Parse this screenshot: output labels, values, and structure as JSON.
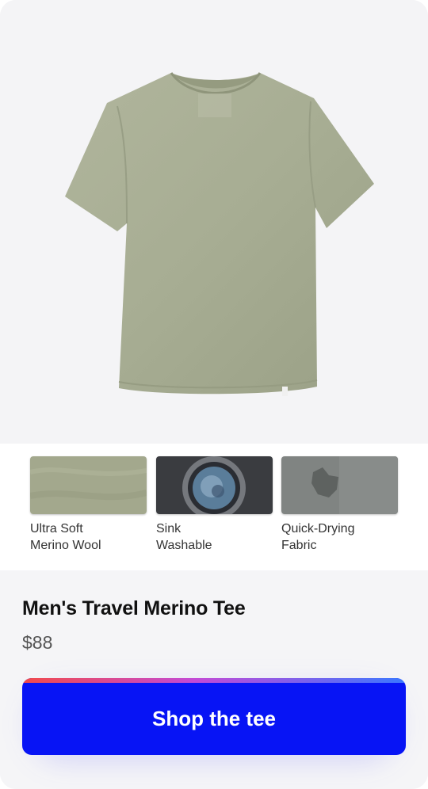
{
  "product": {
    "image_icon": "green-tshirt-image",
    "name": "Men's Travel Merino Tee",
    "price": "$88"
  },
  "features": [
    {
      "label": "Ultra Soft\nMerino Wool",
      "icon": "fabric-texture-thumbnail"
    },
    {
      "label": "Sink\nWashable",
      "icon": "washing-machine-thumbnail"
    },
    {
      "label": "Quick-Drying\nFabric",
      "icon": "drying-fabric-thumbnail"
    }
  ],
  "cta": {
    "label": "Shop the tee"
  },
  "colors": {
    "shirt": "#a7ad93",
    "cta_background": "#0714f5",
    "cta_stripe_start": "#f24a4a",
    "cta_stripe_end": "#3a78ff"
  }
}
